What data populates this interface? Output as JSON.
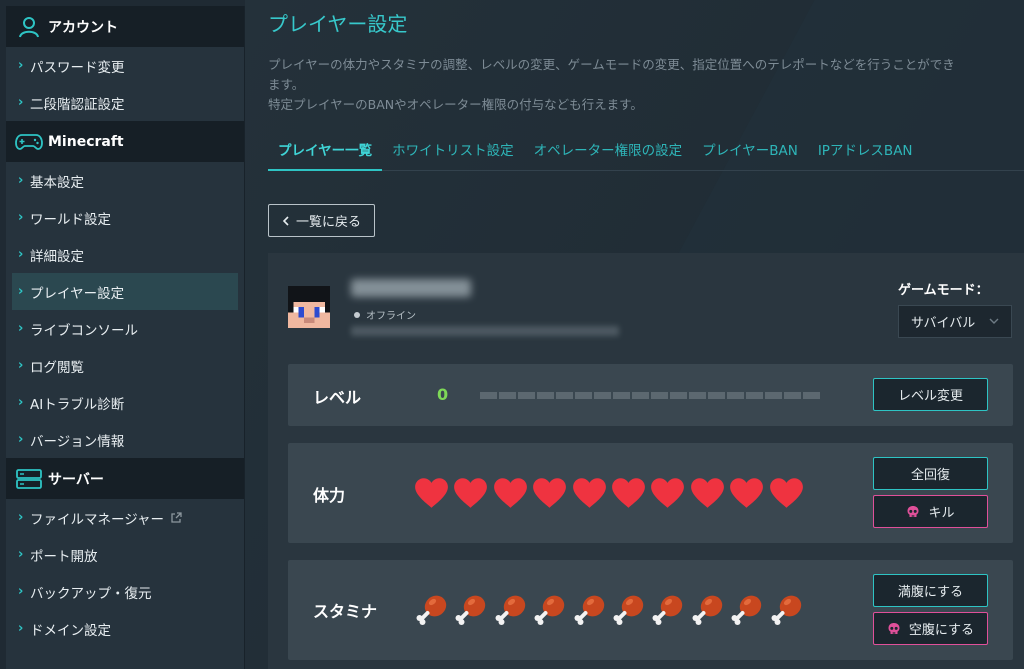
{
  "sidebar": {
    "sections": [
      {
        "title": "アカウント",
        "icon": "user-icon",
        "items": [
          {
            "label": "パスワード変更"
          },
          {
            "label": "二段階認証設定"
          }
        ]
      },
      {
        "title": "Minecraft",
        "icon": "gamepad-icon",
        "items": [
          {
            "label": "基本設定"
          },
          {
            "label": "ワールド設定"
          },
          {
            "label": "詳細設定"
          },
          {
            "label": "プレイヤー設定",
            "active": true
          },
          {
            "label": "ライブコンソール"
          },
          {
            "label": "ログ閲覧"
          },
          {
            "label": "AIトラブル診断"
          },
          {
            "label": "バージョン情報"
          }
        ]
      },
      {
        "title": "サーバー",
        "icon": "server-icon",
        "items": [
          {
            "label": "ファイルマネージャー",
            "external": true
          },
          {
            "label": "ポート開放"
          },
          {
            "label": "バックアップ・復元"
          },
          {
            "label": "ドメイン設定"
          }
        ]
      }
    ]
  },
  "main": {
    "title": "プレイヤー設定",
    "description": [
      "プレイヤーの体力やスタミナの調整、レベルの変更、ゲームモードの変更、指定位置へのテレポートなどを行うことができ",
      "ます。",
      "特定プレイヤーのBANやオペレーター権限の付与なども行えます。"
    ],
    "tabs": [
      {
        "label": "プレイヤー一覧",
        "active": true
      },
      {
        "label": "ホワイトリスト設定"
      },
      {
        "label": "オペレーター権限の設定"
      },
      {
        "label": "プレイヤーBAN"
      },
      {
        "label": "IPアドレスBAN"
      }
    ],
    "back_label": "一覧に戻る",
    "player": {
      "status": "オフライン",
      "gamemode_label": "ゲームモード：",
      "gamemode_value": "サバイバル"
    },
    "level": {
      "label": "レベル",
      "value": "0",
      "xp_segments": 18,
      "xp_progress": 0,
      "button": "レベル変更"
    },
    "health": {
      "label": "体力",
      "hearts": 10,
      "heart_color": "#ef3340",
      "button_heal": "全回復",
      "button_kill": "キル"
    },
    "stamina": {
      "label": "スタミナ",
      "drumsticks": 10,
      "meat_color": "#c8471f",
      "button_fill": "満腹にする",
      "button_empty": "空腹にする"
    }
  },
  "colors": {
    "accent": "#2ec4c4",
    "danger": "#e0509a",
    "level_green": "#7ed957"
  }
}
